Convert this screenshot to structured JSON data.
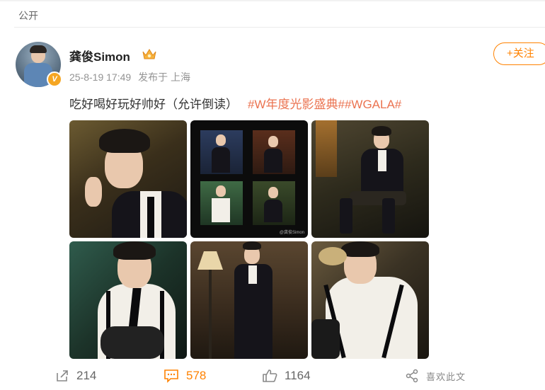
{
  "visibility": "公开",
  "user": {
    "name": "龚俊Simon",
    "verified_badge": "V"
  },
  "post": {
    "time": "25-8-19 17:49",
    "source": "发布于 上海",
    "text": "吃好喝好玩好帅好（允许倒读）",
    "hashtags": "#W年度光影盛典##WGALA#"
  },
  "follow": {
    "label": "+关注"
  },
  "photos": {
    "watermark": "@龚俊Simon"
  },
  "actions": {
    "repost_count": "214",
    "comment_count": "578",
    "like_count": "1164",
    "share_label": "喜欢此文"
  },
  "colors": {
    "accent": "#ff8200",
    "hashtag": "#eb7350",
    "meta": "#939393"
  },
  "icons": [
    "repost-icon",
    "comment-icon",
    "like-icon",
    "share-icon",
    "crown-icon"
  ]
}
